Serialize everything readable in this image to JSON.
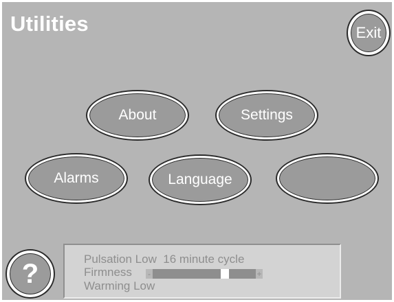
{
  "header": {
    "title": "Utilities"
  },
  "buttons": {
    "exit": "Exit",
    "help": "?",
    "about": "About",
    "settings": "Settings",
    "alarms": "Alarms",
    "language": "Language",
    "blank": ""
  },
  "status": {
    "pulsation": "Pulsation Low  16 minute cycle",
    "firmness_label": "Firmness",
    "firmness_minus": "-",
    "firmness_plus": "+",
    "firmness_level": 0.7,
    "warming": "Warming Low"
  },
  "colors": {
    "background": "#b5b5b5",
    "button_fill": "#9b9b9b",
    "status_panel": "#d3d3d3",
    "status_text": "#8e8e8e"
  },
  "icons": {
    "help": "question-mark-icon"
  }
}
